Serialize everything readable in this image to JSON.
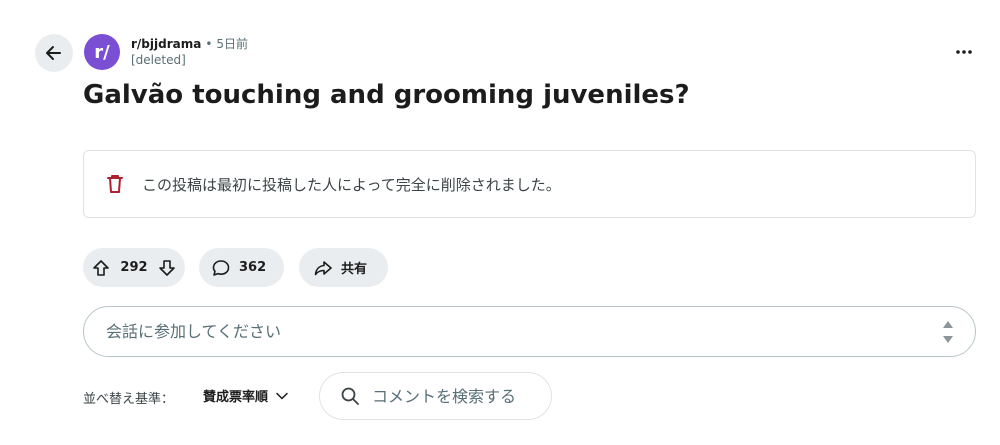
{
  "post": {
    "subreddit": "r/bjjdrama",
    "separator": "•",
    "time_ago": "5日前",
    "author": "[deleted]",
    "title": "Galvão touching and grooming juveniles?",
    "deleted_message": "この投稿は最初に投稿した人によって完全に削除されました。",
    "avatar_text": "r/",
    "avatar_color": "#7b4fd4"
  },
  "actions": {
    "upvotes": "292",
    "comments": "362",
    "share_label": "共有"
  },
  "comment_input": {
    "placeholder": "会話に参加してください"
  },
  "sort": {
    "label": "並べ替え基準：",
    "selected": "賛成票率順"
  },
  "comment_search": {
    "placeholder": "コメントを検索する"
  },
  "colors": {
    "accent_delete": "#b01f2e",
    "pill_bg": "#eaedef"
  }
}
